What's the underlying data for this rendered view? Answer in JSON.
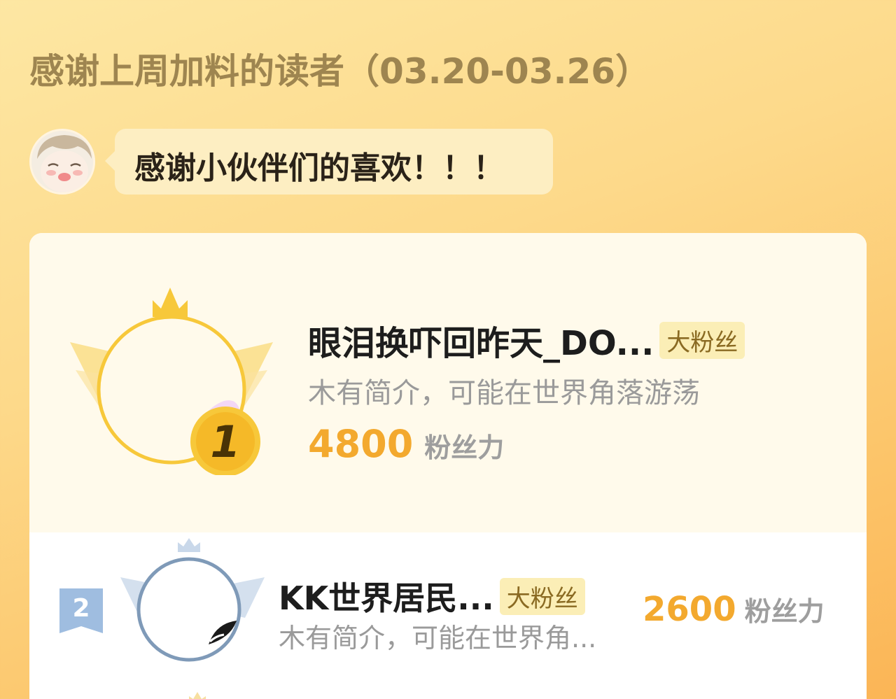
{
  "header": {
    "title": "感谢上周加料的读者（03.20-03.26）"
  },
  "author_message": {
    "text": "感谢小伙伴们的喜欢！！！"
  },
  "ranking": [
    {
      "rank": "1",
      "name": "眼泪换吓回昨天_DO...",
      "badge": "大粉丝",
      "bio": "木有简介，可能在世界角落游荡",
      "score": "4800",
      "score_label": "粉丝力"
    },
    {
      "rank": "2",
      "name": "KK世界居民...",
      "badge": "大粉丝",
      "bio": "木有简介，可能在世界角...",
      "score": "2600",
      "score_label": "粉丝力"
    }
  ],
  "colors": {
    "accent": "#f3a92e",
    "gold": "#f7c83a",
    "silver": "#7f9ab8"
  }
}
